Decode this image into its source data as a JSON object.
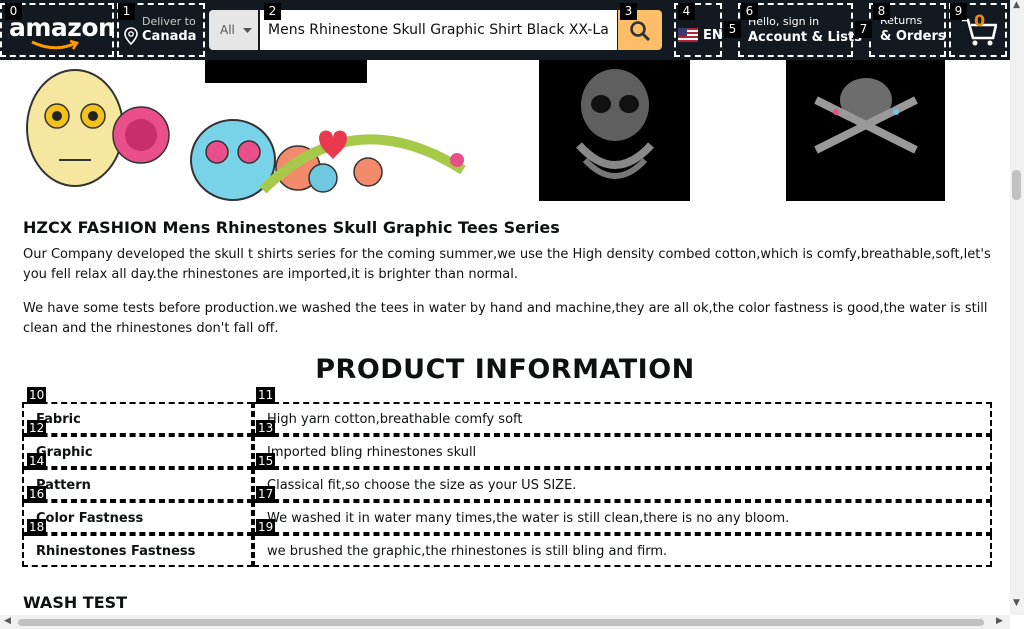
{
  "header": {
    "logo": "amazon",
    "location": {
      "line1": "Deliver to",
      "line2": "Canada"
    },
    "search": {
      "category": "All",
      "query": "Mens Rhinestone Skull Graphic Shirt Black XX-Large"
    },
    "language": "EN",
    "account": {
      "line1": "Hello, sign in",
      "line2": "Account & Lists"
    },
    "returns": {
      "line1": "Returns",
      "line2": "& Orders"
    },
    "cart": {
      "count": "0"
    }
  },
  "markers": [
    "0",
    "1",
    "2",
    "3",
    "4",
    "5",
    "6",
    "7",
    "8",
    "9",
    "10",
    "11",
    "12",
    "13",
    "14",
    "15",
    "16",
    "17",
    "18",
    "19"
  ],
  "content": {
    "brand_title": "HZCX FASHION Mens Rhinestones Skull Graphic Tees Series",
    "para1": "Our Company developed the skull t shirts series for the coming summer,we use the High density combed cotton,which is comfy,breathable,soft,let's you fell relax all day.the rhinestones are imported,it is brighter than normal.",
    "para2": "We have some tests before production.we washed the tees in water by hand and machine,they are all ok,the color fastness is good,the water is still clean and the rhinestones don't fall off.",
    "product_info_heading": "PRODUCT INFORMATION",
    "info_rows": [
      {
        "label": "Fabric",
        "value": "High yarn cotton,breathable comfy soft"
      },
      {
        "label": "Graphic",
        "value": "Imported bling rhinestones skull"
      },
      {
        "label": "Pattern",
        "value": "Classical fit,so choose the size as your US SIZE."
      },
      {
        "label": "Color Fastness",
        "value": "We washed it in water many times,the water is still clean,there is no any bloom."
      },
      {
        "label": "Rhinestones Fastness",
        "value": "we brushed the graphic,the rhinestones is still bling and firm."
      }
    ],
    "wash_test_heading": "WASH TEST"
  },
  "colors": {
    "nav_bg": "#131921",
    "search_button": "#febd69",
    "cart_count": "#f08804"
  }
}
